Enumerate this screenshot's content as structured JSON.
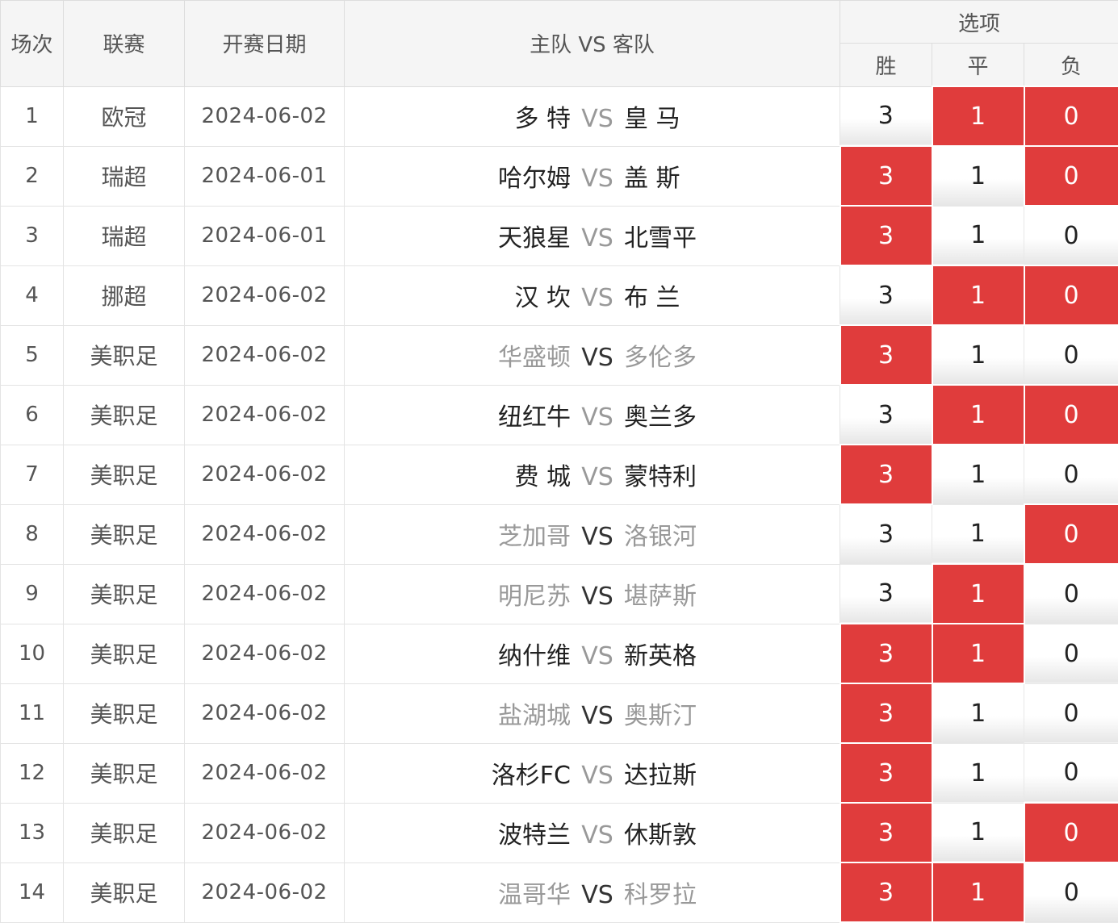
{
  "header": {
    "no": "场次",
    "league": "联赛",
    "date": "开赛日期",
    "match": "主队 VS 客队",
    "options": "选项",
    "win": "胜",
    "draw": "平",
    "lose": "负"
  },
  "vs_label": "VS",
  "colors": {
    "selected": "#e03c3c",
    "dim_team": "#999999"
  },
  "rows": [
    {
      "no": "1",
      "league": "欧冠",
      "date": "2024-06-02",
      "home": "多 特",
      "away": "皇 马",
      "dim": false,
      "win": "3",
      "draw": "1",
      "lose": "0",
      "sel": [
        false,
        true,
        true
      ]
    },
    {
      "no": "2",
      "league": "瑞超",
      "date": "2024-06-01",
      "home": "哈尔姆",
      "away": "盖 斯",
      "dim": false,
      "win": "3",
      "draw": "1",
      "lose": "0",
      "sel": [
        true,
        false,
        true
      ]
    },
    {
      "no": "3",
      "league": "瑞超",
      "date": "2024-06-01",
      "home": "天狼星",
      "away": "北雪平",
      "dim": false,
      "win": "3",
      "draw": "1",
      "lose": "0",
      "sel": [
        true,
        false,
        false
      ]
    },
    {
      "no": "4",
      "league": "挪超",
      "date": "2024-06-02",
      "home": "汉 坎",
      "away": "布 兰",
      "dim": false,
      "win": "3",
      "draw": "1",
      "lose": "0",
      "sel": [
        false,
        true,
        true
      ]
    },
    {
      "no": "5",
      "league": "美职足",
      "date": "2024-06-02",
      "home": "华盛顿",
      "away": "多伦多",
      "dim": true,
      "win": "3",
      "draw": "1",
      "lose": "0",
      "sel": [
        true,
        false,
        false
      ]
    },
    {
      "no": "6",
      "league": "美职足",
      "date": "2024-06-02",
      "home": "纽红牛",
      "away": "奥兰多",
      "dim": false,
      "win": "3",
      "draw": "1",
      "lose": "0",
      "sel": [
        false,
        true,
        true
      ]
    },
    {
      "no": "7",
      "league": "美职足",
      "date": "2024-06-02",
      "home": "费 城",
      "away": "蒙特利",
      "dim": false,
      "win": "3",
      "draw": "1",
      "lose": "0",
      "sel": [
        true,
        false,
        false
      ]
    },
    {
      "no": "8",
      "league": "美职足",
      "date": "2024-06-02",
      "home": "芝加哥",
      "away": "洛银河",
      "dim": true,
      "win": "3",
      "draw": "1",
      "lose": "0",
      "sel": [
        false,
        false,
        true
      ]
    },
    {
      "no": "9",
      "league": "美职足",
      "date": "2024-06-02",
      "home": "明尼苏",
      "away": "堪萨斯",
      "dim": true,
      "win": "3",
      "draw": "1",
      "lose": "0",
      "sel": [
        false,
        true,
        false
      ]
    },
    {
      "no": "10",
      "league": "美职足",
      "date": "2024-06-02",
      "home": "纳什维",
      "away": "新英格",
      "dim": false,
      "win": "3",
      "draw": "1",
      "lose": "0",
      "sel": [
        true,
        true,
        false
      ]
    },
    {
      "no": "11",
      "league": "美职足",
      "date": "2024-06-02",
      "home": "盐湖城",
      "away": "奥斯汀",
      "dim": true,
      "win": "3",
      "draw": "1",
      "lose": "0",
      "sel": [
        true,
        false,
        false
      ]
    },
    {
      "no": "12",
      "league": "美职足",
      "date": "2024-06-02",
      "home": "洛杉FC",
      "away": "达拉斯",
      "dim": false,
      "win": "3",
      "draw": "1",
      "lose": "0",
      "sel": [
        true,
        false,
        false
      ]
    },
    {
      "no": "13",
      "league": "美职足",
      "date": "2024-06-02",
      "home": "波特兰",
      "away": "休斯敦",
      "dim": false,
      "win": "3",
      "draw": "1",
      "lose": "0",
      "sel": [
        true,
        false,
        true
      ]
    },
    {
      "no": "14",
      "league": "美职足",
      "date": "2024-06-02",
      "home": "温哥华",
      "away": "科罗拉",
      "dim": true,
      "win": "3",
      "draw": "1",
      "lose": "0",
      "sel": [
        true,
        true,
        false
      ]
    }
  ]
}
